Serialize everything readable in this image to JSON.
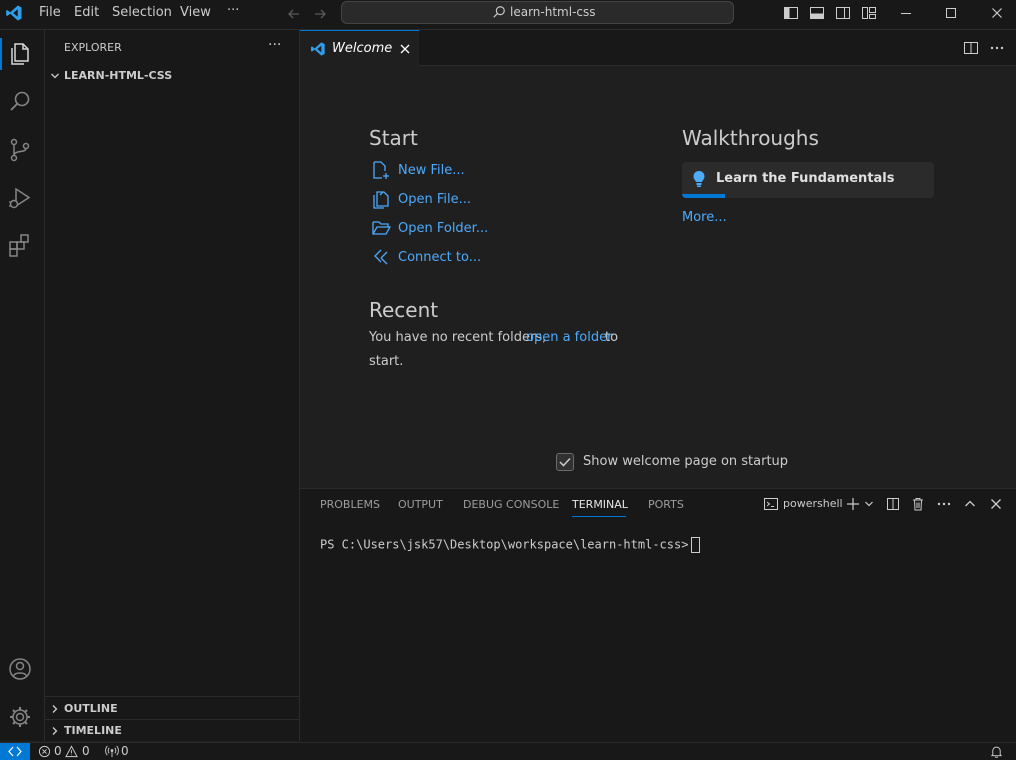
{
  "titlebar": {
    "menu": [
      "File",
      "Edit",
      "Selection",
      "View"
    ],
    "more": "···",
    "search_text": "learn-html-css"
  },
  "sidebar": {
    "title": "EXPLORER",
    "more": "···",
    "folder": "LEARN-HTML-CSS",
    "outline": "OUTLINE",
    "timeline": "TIMELINE"
  },
  "editor": {
    "tab_label": "Welcome"
  },
  "welcome": {
    "start_heading": "Start",
    "start_items": [
      "New File...",
      "Open File...",
      "Open Folder...",
      "Connect to..."
    ],
    "recent_heading": "Recent",
    "recent_text_1": "You have no recent folders,",
    "recent_link": "open a folder",
    "recent_text_2": "to",
    "recent_text_3": "start.",
    "walkthroughs_heading": "Walkthroughs",
    "walkthrough_item": "Learn the Fundamentals",
    "walkthrough_progress": 0.17,
    "more_link": "More...",
    "show_on_startup": "Show welcome page on startup",
    "show_on_startup_checked": true
  },
  "panel": {
    "tabs": [
      "PROBLEMS",
      "OUTPUT",
      "DEBUG CONSOLE",
      "TERMINAL",
      "PORTS"
    ],
    "active_tab": "TERMINAL",
    "shell_name": "powershell",
    "terminal_prompt": "PS C:\\Users\\jsk57\\Desktop\\workspace\\learn-html-css>"
  },
  "statusbar": {
    "errors": "0",
    "warnings": "0",
    "ports": "0"
  },
  "colors": {
    "accent": "#0078d4",
    "link": "#4daafc",
    "background": "#1f1f1f",
    "chrome": "#181818"
  }
}
